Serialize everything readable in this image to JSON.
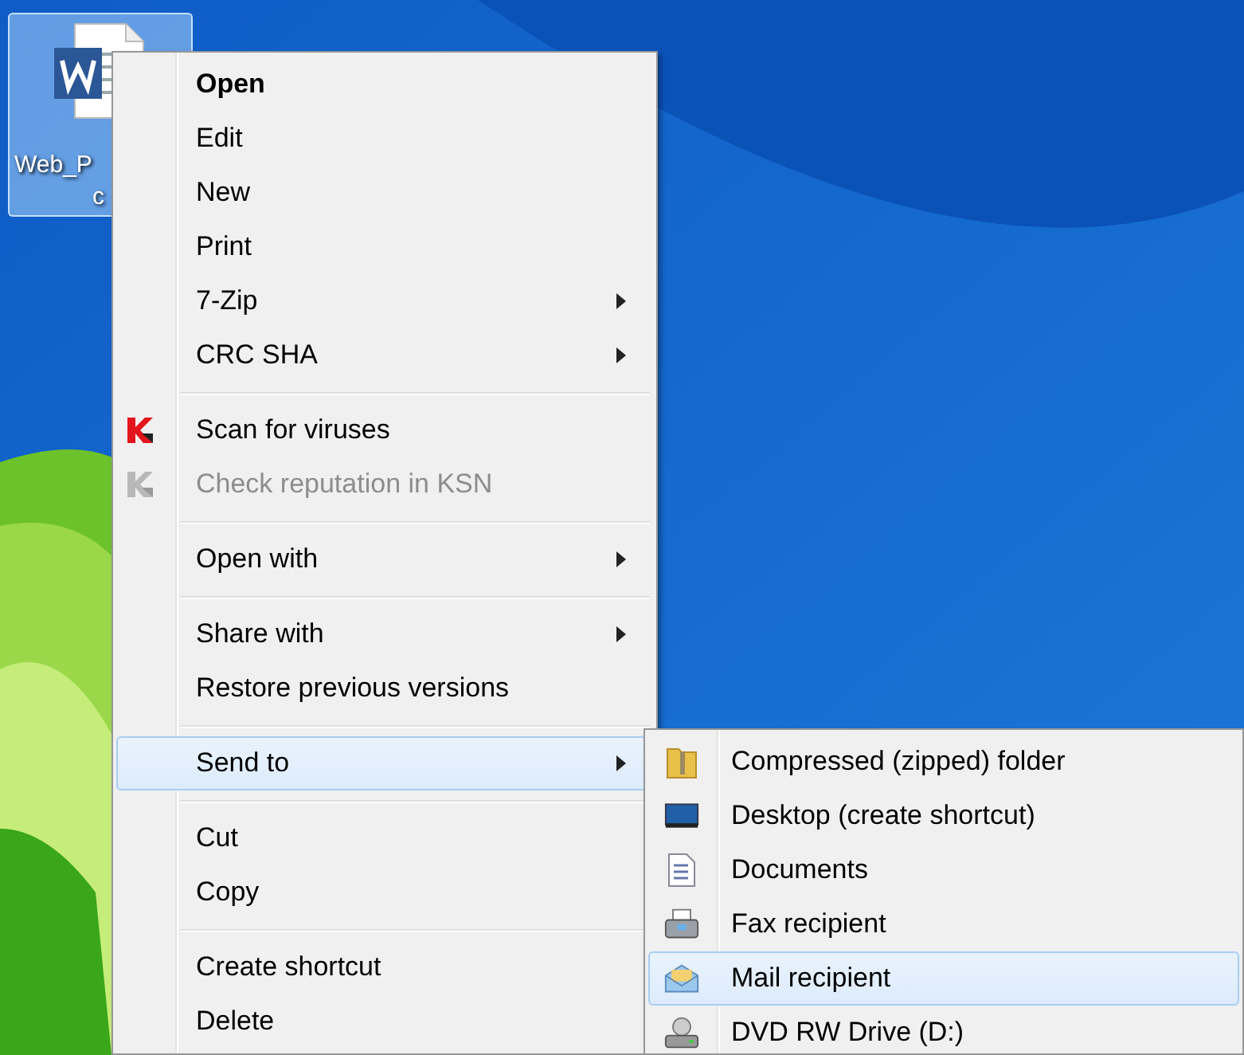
{
  "desktop_icon": {
    "label_lines": [
      "Web_P",
      "c"
    ],
    "selected": true
  },
  "context_menu": {
    "items": [
      {
        "kind": "item",
        "label": "Open",
        "default": true,
        "disabled": false,
        "submenu": false,
        "selected": false
      },
      {
        "kind": "item",
        "label": "Edit",
        "default": false,
        "disabled": false,
        "submenu": false,
        "selected": false
      },
      {
        "kind": "item",
        "label": "New",
        "default": false,
        "disabled": false,
        "submenu": false,
        "selected": false
      },
      {
        "kind": "item",
        "label": "Print",
        "default": false,
        "disabled": false,
        "submenu": false,
        "selected": false
      },
      {
        "kind": "item",
        "label": "7-Zip",
        "default": false,
        "disabled": false,
        "submenu": true,
        "selected": false
      },
      {
        "kind": "item",
        "label": "CRC SHA",
        "default": false,
        "disabled": false,
        "submenu": true,
        "selected": false
      },
      {
        "kind": "separator"
      },
      {
        "kind": "antivirus",
        "label": "Scan for viruses",
        "default": false,
        "disabled": false,
        "submenu": false,
        "selected": false
      },
      {
        "kind": "antivirus",
        "label": "Check reputation in KSN",
        "default": false,
        "disabled": true,
        "submenu": false,
        "selected": false
      },
      {
        "kind": "separator"
      },
      {
        "kind": "item",
        "label": "Open with",
        "default": false,
        "disabled": false,
        "submenu": true,
        "selected": false
      },
      {
        "kind": "separator"
      },
      {
        "kind": "item",
        "label": "Share with",
        "default": false,
        "disabled": false,
        "submenu": true,
        "selected": false
      },
      {
        "kind": "item",
        "label": "Restore previous versions",
        "default": false,
        "disabled": false,
        "submenu": false,
        "selected": false
      },
      {
        "kind": "separator"
      },
      {
        "kind": "item",
        "label": "Send to",
        "default": false,
        "disabled": false,
        "submenu": true,
        "selected": true
      },
      {
        "kind": "separator"
      },
      {
        "kind": "item",
        "label": "Cut",
        "default": false,
        "disabled": false,
        "submenu": false,
        "selected": false
      },
      {
        "kind": "item",
        "label": "Copy",
        "default": false,
        "disabled": false,
        "submenu": false,
        "selected": false
      },
      {
        "kind": "separator"
      },
      {
        "kind": "item",
        "label": "Create shortcut",
        "default": false,
        "disabled": false,
        "submenu": false,
        "selected": false
      },
      {
        "kind": "item",
        "label": "Delete",
        "default": false,
        "disabled": false,
        "submenu": false,
        "selected": false
      }
    ]
  },
  "send_to_menu": {
    "items": [
      {
        "kind": "zip",
        "label": "Compressed (zipped) folder",
        "selected": false
      },
      {
        "kind": "desktop",
        "label": "Desktop (create shortcut)",
        "selected": false
      },
      {
        "kind": "documents",
        "label": "Documents",
        "selected": false
      },
      {
        "kind": "fax",
        "label": "Fax recipient",
        "selected": false
      },
      {
        "kind": "mail",
        "label": "Mail recipient",
        "selected": true
      },
      {
        "kind": "drive",
        "label": "DVD RW Drive (D:)",
        "selected": false
      }
    ]
  }
}
